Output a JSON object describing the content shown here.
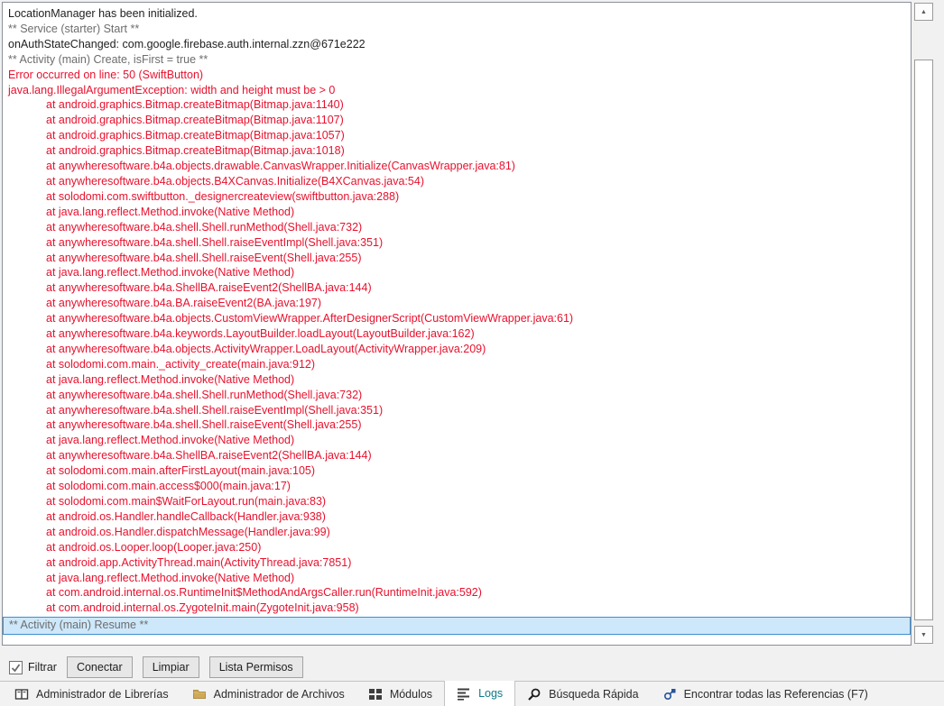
{
  "colors": {
    "normal_text": "#1e1e1e",
    "muted_text": "#6d6d6d",
    "error_text": "#e8112d",
    "selected_line_bg": "#cde8fa",
    "selected_line_border": "#3d8fd0",
    "active_tab_text": "#0e7a8a"
  },
  "log": {
    "lines": [
      {
        "text": "LocationManager has been initialized.",
        "type": "info"
      },
      {
        "text": "** Service (starter) Start **",
        "type": "status"
      },
      {
        "text": "onAuthStateChanged: com.google.firebase.auth.internal.zzn@671e222",
        "type": "info"
      },
      {
        "text": "** Activity (main) Create, isFirst = true **",
        "type": "status"
      },
      {
        "text": "Error occurred on line: 50 (SwiftButton)",
        "type": "error"
      },
      {
        "text": "java.lang.IllegalArgumentException: width and height must be > 0",
        "type": "error"
      },
      {
        "text": "at android.graphics.Bitmap.createBitmap(Bitmap.java:1140)",
        "type": "error",
        "indent": true
      },
      {
        "text": "at android.graphics.Bitmap.createBitmap(Bitmap.java:1107)",
        "type": "error",
        "indent": true
      },
      {
        "text": "at android.graphics.Bitmap.createBitmap(Bitmap.java:1057)",
        "type": "error",
        "indent": true
      },
      {
        "text": "at android.graphics.Bitmap.createBitmap(Bitmap.java:1018)",
        "type": "error",
        "indent": true
      },
      {
        "text": "at anywheresoftware.b4a.objects.drawable.CanvasWrapper.Initialize(CanvasWrapper.java:81)",
        "type": "error",
        "indent": true
      },
      {
        "text": "at anywheresoftware.b4a.objects.B4XCanvas.Initialize(B4XCanvas.java:54)",
        "type": "error",
        "indent": true
      },
      {
        "text": "at solodomi.com.swiftbutton._designercreateview(swiftbutton.java:288)",
        "type": "error",
        "indent": true
      },
      {
        "text": "at java.lang.reflect.Method.invoke(Native Method)",
        "type": "error",
        "indent": true
      },
      {
        "text": "at anywheresoftware.b4a.shell.Shell.runMethod(Shell.java:732)",
        "type": "error",
        "indent": true
      },
      {
        "text": "at anywheresoftware.b4a.shell.Shell.raiseEventImpl(Shell.java:351)",
        "type": "error",
        "indent": true
      },
      {
        "text": "at anywheresoftware.b4a.shell.Shell.raiseEvent(Shell.java:255)",
        "type": "error",
        "indent": true
      },
      {
        "text": "at java.lang.reflect.Method.invoke(Native Method)",
        "type": "error",
        "indent": true
      },
      {
        "text": "at anywheresoftware.b4a.ShellBA.raiseEvent2(ShellBA.java:144)",
        "type": "error",
        "indent": true
      },
      {
        "text": "at anywheresoftware.b4a.BA.raiseEvent2(BA.java:197)",
        "type": "error",
        "indent": true
      },
      {
        "text": "at anywheresoftware.b4a.objects.CustomViewWrapper.AfterDesignerScript(CustomViewWrapper.java:61)",
        "type": "error",
        "indent": true
      },
      {
        "text": "at anywheresoftware.b4a.keywords.LayoutBuilder.loadLayout(LayoutBuilder.java:162)",
        "type": "error",
        "indent": true
      },
      {
        "text": "at anywheresoftware.b4a.objects.ActivityWrapper.LoadLayout(ActivityWrapper.java:209)",
        "type": "error",
        "indent": true
      },
      {
        "text": "at solodomi.com.main._activity_create(main.java:912)",
        "type": "error",
        "indent": true
      },
      {
        "text": "at java.lang.reflect.Method.invoke(Native Method)",
        "type": "error",
        "indent": true
      },
      {
        "text": "at anywheresoftware.b4a.shell.Shell.runMethod(Shell.java:732)",
        "type": "error",
        "indent": true
      },
      {
        "text": "at anywheresoftware.b4a.shell.Shell.raiseEventImpl(Shell.java:351)",
        "type": "error",
        "indent": true
      },
      {
        "text": "at anywheresoftware.b4a.shell.Shell.raiseEvent(Shell.java:255)",
        "type": "error",
        "indent": true
      },
      {
        "text": "at java.lang.reflect.Method.invoke(Native Method)",
        "type": "error",
        "indent": true
      },
      {
        "text": "at anywheresoftware.b4a.ShellBA.raiseEvent2(ShellBA.java:144)",
        "type": "error",
        "indent": true
      },
      {
        "text": "at solodomi.com.main.afterFirstLayout(main.java:105)",
        "type": "error",
        "indent": true
      },
      {
        "text": "at solodomi.com.main.access$000(main.java:17)",
        "type": "error",
        "indent": true
      },
      {
        "text": "at solodomi.com.main$WaitForLayout.run(main.java:83)",
        "type": "error",
        "indent": true
      },
      {
        "text": "at android.os.Handler.handleCallback(Handler.java:938)",
        "type": "error",
        "indent": true
      },
      {
        "text": "at android.os.Handler.dispatchMessage(Handler.java:99)",
        "type": "error",
        "indent": true
      },
      {
        "text": "at android.os.Looper.loop(Looper.java:250)",
        "type": "error",
        "indent": true
      },
      {
        "text": "at android.app.ActivityThread.main(ActivityThread.java:7851)",
        "type": "error",
        "indent": true
      },
      {
        "text": "at java.lang.reflect.Method.invoke(Native Method)",
        "type": "error",
        "indent": true
      },
      {
        "text": "at com.android.internal.os.RuntimeInit$MethodAndArgsCaller.run(RuntimeInit.java:592)",
        "type": "error",
        "indent": true
      },
      {
        "text": "at com.android.internal.os.ZygoteInit.main(ZygoteInit.java:958)",
        "type": "error",
        "indent": true
      },
      {
        "text": "** Activity (main) Resume **",
        "type": "status",
        "selected": true
      }
    ]
  },
  "controls": {
    "filter_checkbox": {
      "label": "Filtrar",
      "checked": true
    },
    "buttons": [
      {
        "name": "connect-button",
        "label": "Conectar"
      },
      {
        "name": "clear-button",
        "label": "Limpiar"
      },
      {
        "name": "permissions-list-button",
        "label": "Lista Permisos"
      }
    ]
  },
  "tab_bar": {
    "items": [
      {
        "name": "tab-library-manager",
        "label": "Administrador de Librerías",
        "icon": "library-book-icon",
        "active": false
      },
      {
        "name": "tab-files-manager",
        "label": "Administrador de Archivos",
        "icon": "folder-icon",
        "active": false
      },
      {
        "name": "tab-modules",
        "label": "Módulos",
        "icon": "modules-grid-icon",
        "active": false
      },
      {
        "name": "tab-logs",
        "label": "Logs",
        "icon": "log-lines-icon",
        "active": true
      },
      {
        "name": "tab-quick-search",
        "label": "Búsqueda Rápida",
        "icon": "search-icon",
        "active": false
      },
      {
        "name": "tab-find-all-references",
        "label": "Encontrar todas las Referencias (F7)",
        "icon": "find-references-icon",
        "active": false
      }
    ]
  },
  "scrollbar": {
    "up_arrow": "▲",
    "down_arrow": "▼",
    "check_mark": "✓"
  }
}
